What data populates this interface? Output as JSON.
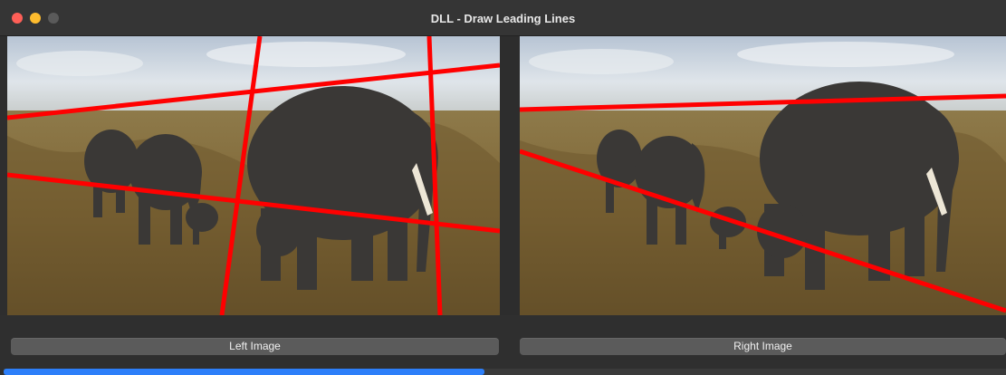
{
  "window": {
    "title": "DLL - Draw Leading Lines"
  },
  "buttons": {
    "left_label": "Left Image",
    "right_label": "Right Image"
  },
  "progress": {
    "value_percent": 48
  },
  "colors": {
    "line": "#ff0000",
    "accent": "#2d7ff9"
  }
}
